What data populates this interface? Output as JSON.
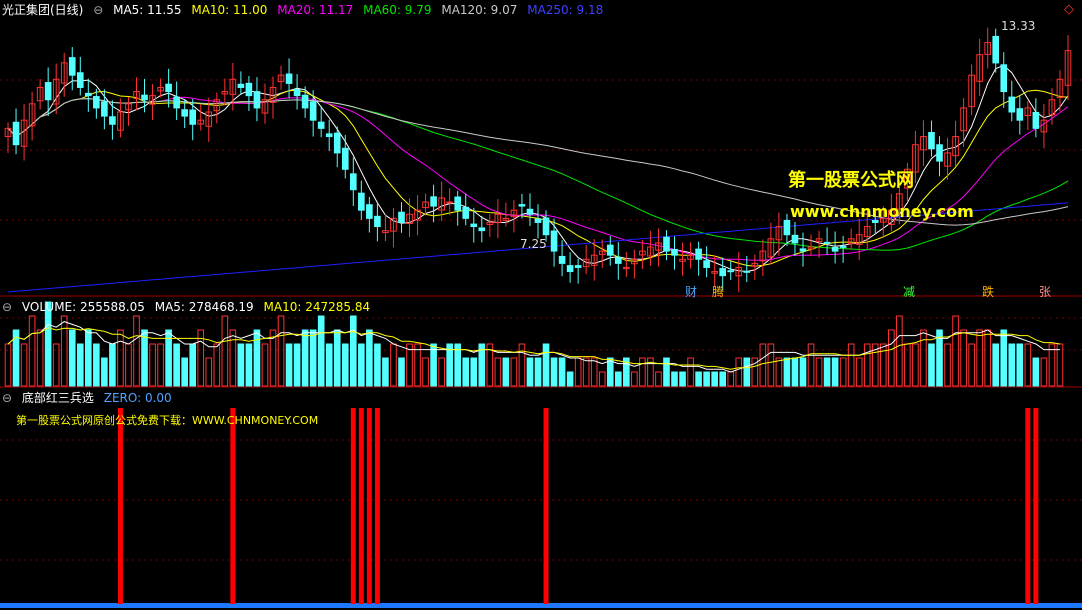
{
  "colors": {
    "up": "#ff3232",
    "down": "#54ffff",
    "ma5": "#ffffff",
    "ma10": "#ffff00",
    "ma20": "#ff00ff",
    "ma60": "#00e600",
    "ma120": "#c8c8c8",
    "ma250": "#2020ff",
    "grid": "#7a0000",
    "signal": "#ff0000",
    "zero": "#1e78ff"
  },
  "main_panel": {
    "stock": "光正集团(日线)",
    "ma": [
      {
        "label": "MA5: 11.55",
        "color": "#ffffff"
      },
      {
        "label": "MA10: 11.00",
        "color": "#ffff00"
      },
      {
        "label": "MA20: 11.17",
        "color": "#ff00ff"
      },
      {
        "label": "MA60: 9.79",
        "color": "#00e600"
      },
      {
        "label": "MA120: 9.07",
        "color": "#c8c8c8"
      },
      {
        "label": "MA250: 9.18",
        "color": "#2020ff"
      }
    ],
    "high_label": "13.33",
    "low_label": "7.25",
    "events": [
      "财",
      "腾",
      "减",
      "跌",
      "张"
    ]
  },
  "volume_panel": {
    "title": "VOLUME: 255588.05",
    "ma5": "MA5: 278468.19",
    "ma10": "MA10: 247285.84"
  },
  "signal_panel": {
    "title": "底部红三兵选",
    "zero": "ZERO: 0.00",
    "note": "第一股票公式网原创公式免费下载：WWW.CHNMONEY.COM"
  },
  "watermark": {
    "line1": "第一股票公式网",
    "line2": "www.chnmoney.com"
  },
  "chart_data": [
    {
      "type": "candlestick",
      "ylim": [
        7.0,
        13.6
      ],
      "annotations": [
        {
          "text": "13.33",
          "value": 13.33
        },
        {
          "text": "7.25",
          "value": 7.25
        }
      ],
      "close": [
        11.0,
        10.6,
        11.2,
        11.6,
        12.0,
        11.7,
        12.2,
        12.6,
        12.3,
        12.0,
        11.8,
        11.5,
        11.3,
        11.1,
        11.4,
        11.6,
        11.9,
        11.7,
        11.8,
        12.0,
        11.9,
        11.5,
        11.3,
        11.1,
        11.2,
        11.4,
        11.7,
        11.9,
        12.2,
        12.0,
        11.8,
        11.5,
        11.7,
        12.0,
        12.3,
        12.1,
        11.8,
        11.5,
        11.2,
        11.0,
        10.8,
        10.4,
        10.0,
        9.5,
        9.0,
        8.8,
        8.6,
        8.5,
        8.8,
        8.7,
        8.9,
        9.0,
        9.2,
        9.1,
        9.3,
        9.2,
        9.0,
        8.8,
        8.6,
        8.5,
        8.7,
        8.9,
        8.8,
        9.0,
        9.1,
        8.9,
        8.7,
        8.4,
        8.0,
        7.7,
        7.5,
        7.6,
        7.8,
        7.9,
        8.0,
        7.9,
        7.7,
        7.6,
        7.8,
        8.0,
        8.1,
        8.2,
        8.0,
        7.9,
        7.8,
        7.9,
        7.8,
        7.6,
        7.5,
        7.4,
        7.5,
        7.6,
        7.5,
        7.7,
        8.0,
        8.3,
        8.6,
        8.4,
        8.2,
        8.0,
        8.1,
        8.3,
        8.2,
        8.0,
        8.1,
        8.3,
        8.4,
        8.6,
        8.7,
        8.8,
        9.0,
        9.4,
        10.0,
        10.6,
        10.8,
        10.5,
        10.2,
        10.4,
        10.8,
        11.5,
        12.3,
        12.8,
        13.1,
        12.6,
        11.9,
        11.4,
        11.2,
        11.5,
        11.0,
        11.2,
        11.7,
        12.2,
        12.9
      ]
    },
    {
      "type": "bar",
      "series_name": "VOLUME",
      "values": [
        3,
        4,
        3,
        5,
        4,
        6,
        3,
        5,
        4,
        3,
        4,
        3,
        2,
        3,
        4,
        3,
        5,
        4,
        3,
        3,
        4,
        3,
        2,
        3,
        4,
        2,
        3,
        5,
        4,
        3,
        3,
        4,
        3,
        4,
        5,
        3,
        3,
        4,
        4,
        5,
        3,
        4,
        3,
        5,
        3,
        4,
        3,
        2,
        3,
        2,
        3,
        3,
        2,
        3,
        2,
        3,
        3,
        2,
        2,
        3,
        3,
        2,
        2,
        2,
        3,
        2,
        2,
        3,
        2,
        2,
        1,
        2,
        2,
        2,
        1,
        2,
        1,
        2,
        1,
        2,
        2,
        1,
        2,
        1,
        1,
        2,
        1,
        1,
        1,
        1,
        1,
        2,
        2,
        2,
        3,
        3,
        2,
        2,
        2,
        2,
        3,
        2,
        2,
        2,
        2,
        3,
        2,
        3,
        3,
        3,
        4,
        5,
        3,
        3,
        4,
        3,
        4,
        3,
        5,
        4,
        3,
        4,
        4,
        3,
        4,
        3,
        3,
        3,
        2,
        2,
        3,
        3
      ]
    },
    {
      "type": "bar",
      "series_name": "底部红三兵选",
      "signal_index": [
        14,
        28,
        43,
        44,
        45,
        46,
        67,
        127,
        128
      ]
    }
  ]
}
